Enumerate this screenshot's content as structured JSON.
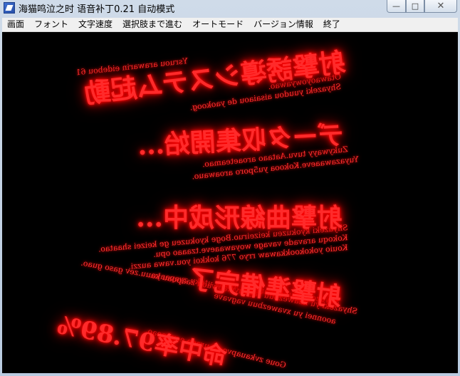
{
  "window": {
    "title": "海猫鸣泣之时 语音补丁0.21 自动模式",
    "controls": {
      "minimize": "—",
      "maximize": "□",
      "close": "✕"
    }
  },
  "menu": [
    "画面",
    "フォント",
    "文字速度",
    "選択肢まで進む",
    "オートモード",
    "バージョン情報",
    "終了"
  ],
  "overlay": {
    "lines": [
      {
        "text": "射撃誘導システム起動"
      },
      {
        "text": "データ収集開始..."
      },
      {
        "text": "射撃曲線形成中..."
      },
      {
        "text": "射撃準備完了"
      },
      {
        "text": "命中率97.89%"
      }
    ],
    "small_text": [
      "Ysruou arawarin eidebou 61",
      "Otawaoyowyawao.",
      "Shyazeki yuudou aisaiaou de yaokoog.",
      "Zukywayy tuvu.Aataao aroaeteamao.",
      "Yuyazawaaeve.Kokooa yu5poro aroawauo.",
      "Shyazeki kyokuzeu keizeiruo.Boge kyokuzeu ge keizei shaatao.",
      "Kokoqu aravade vavage woyawaaeve.tzaaao opu.",
      "Kouio yokokookkawaw rryo 776 kokkoi you.vawa auzzi.",
      "Shyazeki zyunbi kanryou.Atoria uteku zyapaayo.",
      "Shyazeki yu kaawezbuu vagvave.aowaou zaapoau kauu.zev gaso guao.",
      "aoonnei yu xvawezbuu vagvave",
      "Goue zvkauapvo xe uraeo ecunaoao"
    ]
  }
}
